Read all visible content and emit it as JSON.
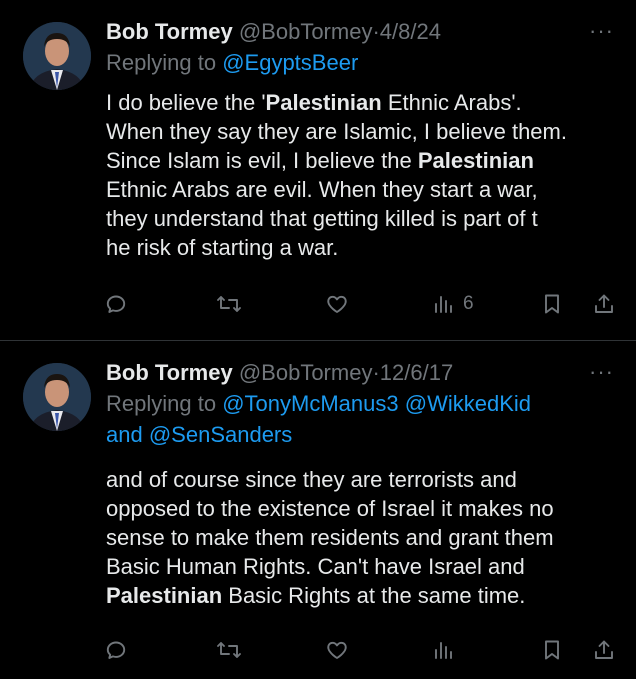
{
  "tweets": [
    {
      "name": "Bob Tormey",
      "handle": "@BobTormey",
      "sep": "·",
      "date": "4/8/24",
      "more": "···",
      "replying_prefix": "Replying to",
      "replying_to": [
        "@EgyptsBeer"
      ],
      "body_lines": [
        [
          {
            "t": "I do believe the '"
          },
          {
            "t": "Palestinian",
            "b": true
          },
          {
            "t": " Ethnic Arabs'."
          }
        ],
        [
          {
            "t": "When they say they are Islamic, I believe them."
          }
        ],
        [
          {
            "t": "Since Islam is evil, I believe the "
          },
          {
            "t": "Palestinian",
            "b": true
          }
        ],
        [
          {
            "t": "Ethnic Arabs are evil. When they start a war,"
          }
        ],
        [
          {
            "t": "they understand that getting killed is part of t"
          }
        ],
        [
          {
            "t": "he risk of starting a war."
          }
        ]
      ],
      "views": "6"
    },
    {
      "name": "Bob Tormey",
      "handle": "@BobTormey",
      "sep": "·",
      "date": "12/6/17",
      "more": "···",
      "replying_prefix": "Replying to",
      "replying_to": [
        "@TonyMcManus3",
        "@WikkedKid"
      ],
      "replying_and": "and",
      "replying_last": "@SenSanders",
      "body_lines": [
        [
          {
            "t": "and of course since they are terrorists and"
          }
        ],
        [
          {
            "t": "opposed to the existence of Israel it makes no"
          }
        ],
        [
          {
            "t": "sense to make them residents and grant them"
          }
        ],
        [
          {
            "t": "Basic Human  Rights. Can't have Israel and"
          }
        ],
        [
          {
            "t": "Palestinian",
            "b": true
          },
          {
            "t": " Basic Rights at the same time."
          }
        ]
      ],
      "views": ""
    }
  ],
  "icons": [
    "reply-icon",
    "retweet-icon",
    "like-icon",
    "views-icon",
    "bookmark-icon",
    "share-icon",
    "more-icon"
  ],
  "colors": {
    "background": "#000000",
    "text": "#e7e9ea",
    "muted": "#71767b",
    "link": "#1d9bf0",
    "divider": "#2f3336"
  }
}
